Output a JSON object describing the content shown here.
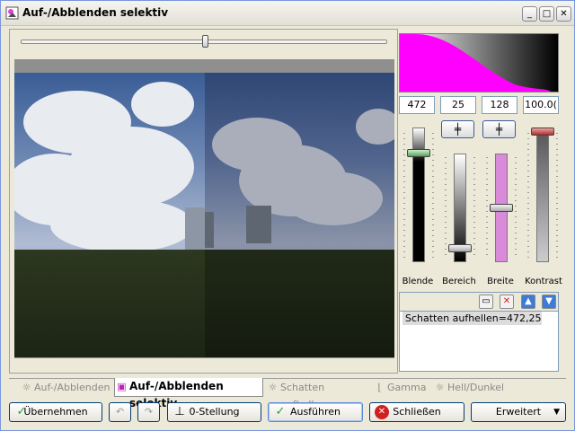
{
  "window": {
    "title": "Auf-/Abblenden selektiv",
    "controls": {
      "minimize": "_",
      "maximize": "□",
      "close": "✕"
    }
  },
  "values": {
    "blende": "472",
    "bereich": "25",
    "breite": "128",
    "kontrast": "100.0("
  },
  "sliders": {
    "labels": [
      "Blende",
      "Bereich",
      "Breite",
      "Kontrast"
    ],
    "blende_level": 0.83,
    "bereich_level": 0.1,
    "breite_level": 0.5,
    "kontrast_level": 1.0
  },
  "preset_list": {
    "items": [
      "Schatten aufhellen=472,25,..."
    ]
  },
  "tabs": [
    {
      "label": "Auf-/Abblenden",
      "icon": "sun-icon"
    },
    {
      "label": "Auf-/Abblenden selektiv",
      "icon": "app-icon",
      "active": true
    },
    {
      "label": "Schatten aufhellen",
      "icon": "sun-icon"
    },
    {
      "label": "Gamma",
      "icon": "curve-icon"
    },
    {
      "label": "Hell/Dunkel",
      "icon": "sun-icon"
    }
  ],
  "buttons": {
    "apply": "Übernehmen",
    "zero": "0-Stellung",
    "run": "Ausführen",
    "close": "Schließen",
    "advanced": "Erweitert"
  },
  "colors": {
    "histogram_fill": "#ff00ff",
    "breite_fill": "#d98ad9",
    "accent": "#3e7bd6"
  }
}
